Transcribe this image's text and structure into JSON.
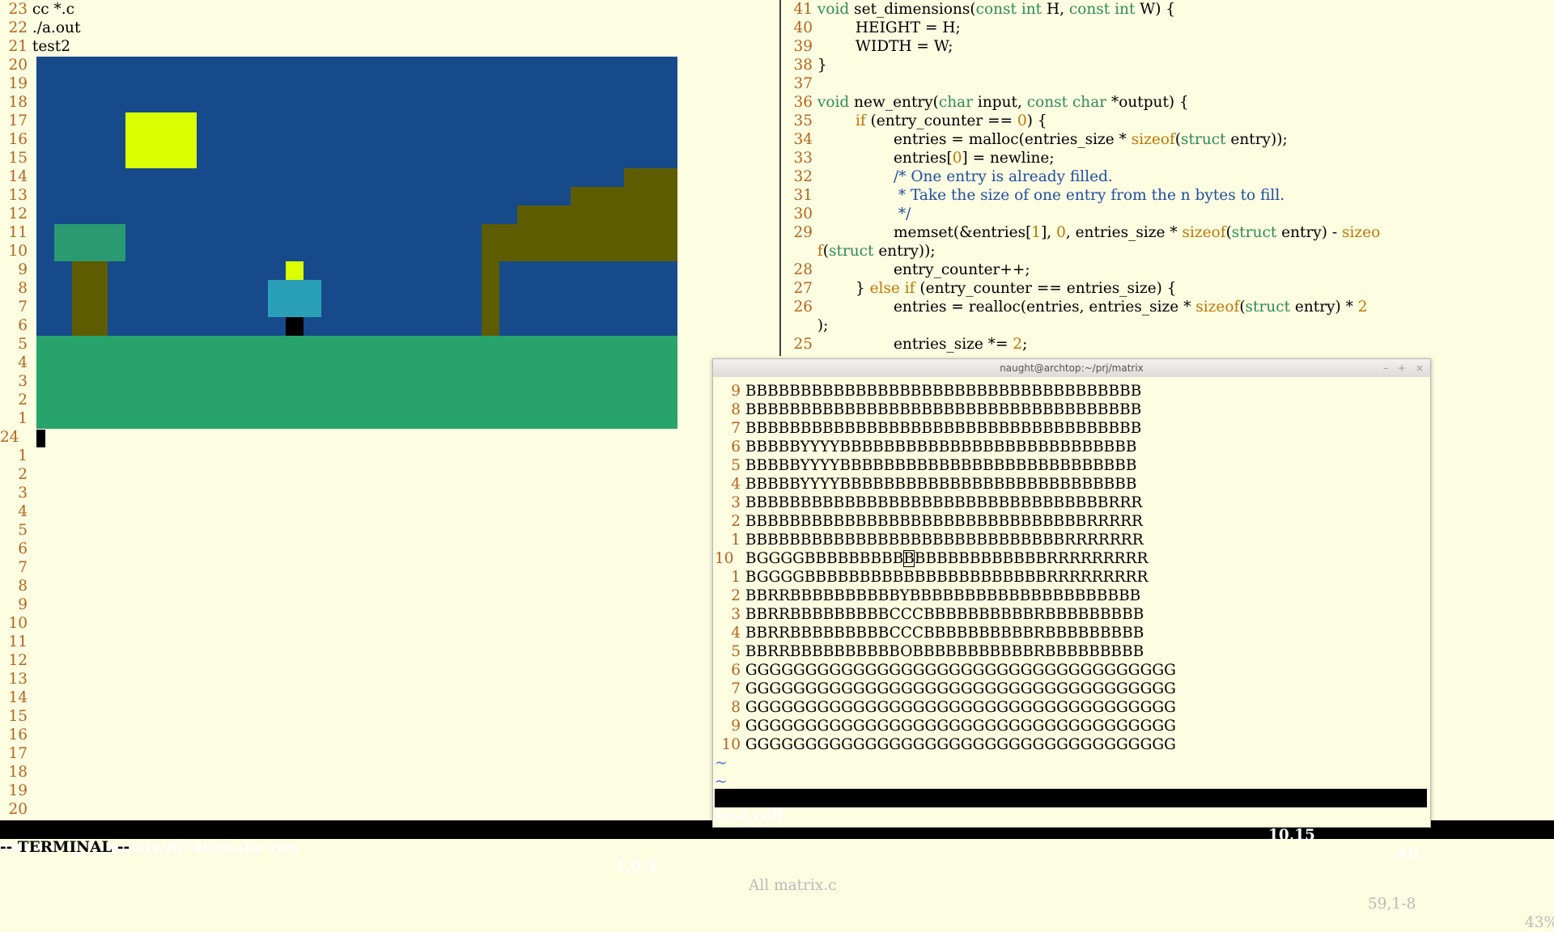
{
  "left": {
    "lines": [
      {
        "n": "23",
        "t": "cc *.c"
      },
      {
        "n": "22",
        "t": "./a.out"
      },
      {
        "n": "21",
        "t": "test2"
      },
      {
        "n": "20",
        "t": ""
      },
      {
        "n": "19",
        "t": ""
      },
      {
        "n": "18",
        "t": ""
      },
      {
        "n": "17",
        "t": ""
      },
      {
        "n": "16",
        "t": ""
      },
      {
        "n": "15",
        "t": ""
      },
      {
        "n": "14",
        "t": ""
      },
      {
        "n": "13",
        "t": ""
      },
      {
        "n": "12",
        "t": ""
      },
      {
        "n": "11",
        "t": ""
      },
      {
        "n": "10",
        "t": ""
      },
      {
        "n": "9",
        "t": ""
      },
      {
        "n": "8",
        "t": ""
      },
      {
        "n": "7",
        "t": ""
      },
      {
        "n": "6",
        "t": ""
      },
      {
        "n": "5",
        "t": ""
      },
      {
        "n": "4",
        "t": ""
      },
      {
        "n": "3",
        "t": ""
      },
      {
        "n": "2",
        "t": ""
      },
      {
        "n": "1",
        "t": ""
      },
      {
        "n": "24",
        "t": ""
      },
      {
        "n": "1",
        "t": ""
      },
      {
        "n": "2",
        "t": ""
      },
      {
        "n": "3",
        "t": ""
      },
      {
        "n": "4",
        "t": ""
      },
      {
        "n": "5",
        "t": ""
      },
      {
        "n": "6",
        "t": ""
      },
      {
        "n": "7",
        "t": ""
      },
      {
        "n": "8",
        "t": ""
      },
      {
        "n": "9",
        "t": ""
      },
      {
        "n": "10",
        "t": ""
      },
      {
        "n": "11",
        "t": ""
      },
      {
        "n": "12",
        "t": ""
      },
      {
        "n": "13",
        "t": ""
      },
      {
        "n": "14",
        "t": ""
      },
      {
        "n": "15",
        "t": ""
      },
      {
        "n": "16",
        "t": ""
      },
      {
        "n": "17",
        "t": ""
      },
      {
        "n": "18",
        "t": ""
      },
      {
        "n": "19",
        "t": ""
      },
      {
        "n": "20",
        "t": ""
      }
    ]
  },
  "scene": {
    "colors": {
      "sky": "#174a8a",
      "sun": "#d9ff00",
      "ground": "#27a36b",
      "leaves": "#2a9a72",
      "trunk": "#5e5c00",
      "player_head": "#d9ff00",
      "player_body": "#2aa0b8",
      "player_legs": "#000000"
    }
  },
  "code": {
    "lines": [
      {
        "n": "41",
        "h": "<span class='kw'>void</span> set_dimensions(<span class='kw'>const int</span> H, <span class='kw'>const int</span> W) {"
      },
      {
        "n": "40",
        "h": "        HEIGHT = H;"
      },
      {
        "n": "39",
        "h": "        WIDTH = W;"
      },
      {
        "n": "38",
        "h": "}"
      },
      {
        "n": "37",
        "h": ""
      },
      {
        "n": "36",
        "h": "<span class='kw'>void</span> new_entry(<span class='kw'>char</span> input, <span class='kw'>const char</span> *output) {"
      },
      {
        "n": "35",
        "h": "        <span class='cond'>if</span> (entry_counter == <span class='nm'>0</span>) {"
      },
      {
        "n": "34",
        "h": "                entries = malloc(entries_size * <span class='cond'>sizeof</span>(<span class='kw'>struct</span> entry));"
      },
      {
        "n": "33",
        "h": "                entries[<span class='nm'>0</span>] = newline;"
      },
      {
        "n": "32",
        "h": "                <span class='cmt'>/* One entry is already filled.</span>"
      },
      {
        "n": "31",
        "h": "<span class='cmt'>                 * Take the size of one entry from the n bytes to fill.</span>"
      },
      {
        "n": "30",
        "h": "<span class='cmt'>                 */</span>"
      },
      {
        "n": "29",
        "h": "                memset(&amp;entries[<span class='nm'>1</span>], <span class='nm'>0</span>, entries_size * <span class='cond'>sizeof</span>(<span class='kw'>struct</span> entry) - <span class='cond'>sizeo</span>"
      },
      {
        "n": "",
        "h": "<span class='cond'>f</span>(<span class='kw'>struct</span> entry));"
      },
      {
        "n": "28",
        "h": "                entry_counter++;"
      },
      {
        "n": "27",
        "h": "        } <span class='cond'>else if</span> (entry_counter == entries_size) {"
      },
      {
        "n": "26",
        "h": "                entries = realloc(entries, entries_size * <span class='cond'>sizeof</span>(<span class='kw'>struct</span> entry) * <span class='nm'>2</span>"
      },
      {
        "n": "",
        "h": ");"
      },
      {
        "n": "25",
        "h": "                entries_size *= <span class='nm'>2</span>;"
      }
    ]
  },
  "popup": {
    "title": "naught@archtop:~/prj/matrix",
    "buttons": [
      "–",
      "+",
      "×"
    ],
    "lines": [
      {
        "n": "9",
        "t": "BBBBBBBBBBBBBBBBBBBBBBBBBBBBBBBBBBBB"
      },
      {
        "n": "8",
        "t": "BBBBBBBBBBBBBBBBBBBBBBBBBBBBBBBBBBBB"
      },
      {
        "n": "7",
        "t": "BBBBBBBBBBBBBBBBBBBBBBBBBBBBBBBBBBBB"
      },
      {
        "n": "6",
        "t": "BBBBBYYYYBBBBBBBBBBBBBBBBBBBBBBBBBBB"
      },
      {
        "n": "5",
        "t": "BBBBBYYYYBBBBBBBBBBBBBBBBBBBBBBBBBBB"
      },
      {
        "n": "4",
        "t": "BBBBBYYYYBBBBBBBBBBBBBBBBBBBBBBBBBBB"
      },
      {
        "n": "3",
        "t": "BBBBBBBBBBBBBBBBBBBBBBBBBBBBBBBBBRRR"
      },
      {
        "n": "2",
        "t": "BBBBBBBBBBBBBBBBBBBBBBBBBBBBBBBRRRRR"
      },
      {
        "n": "1",
        "t": "BBBBBBBBBBBBBBBBBBBBBBBBBBBBBRRRRRRR"
      },
      {
        "n": "10",
        "t": "BGGGGBBBBBBBBBBBBBBBBBBBBBBRRRRRRRRR",
        "cur": true
      },
      {
        "n": "1",
        "t": "BGGGGBBBBBBBBBBBBBBBBBBBBBBRRRRRRRRR"
      },
      {
        "n": "2",
        "t": "BBRRBBBBBBBBBBYBBBBBBBBBBBBBBBBBBBBB"
      },
      {
        "n": "3",
        "t": "BBRRBBBBBBBBBCCCBBBBBBBBBBRBBBBBBBBB"
      },
      {
        "n": "4",
        "t": "BBRRBBBBBBBBBCCCBBBBBBBBBBRBBBBBBBBB"
      },
      {
        "n": "5",
        "t": "BBRRBBBBBBBBBBOBBBBBBBBBBBRBBBBBBBBB"
      },
      {
        "n": "6",
        "t": "GGGGGGGGGGGGGGGGGGGGGGGGGGGGGGGGGGGG"
      },
      {
        "n": "7",
        "t": "GGGGGGGGGGGGGGGGGGGGGGGGGGGGGGGGGGGG"
      },
      {
        "n": "8",
        "t": "GGGGGGGGGGGGGGGGGGGGGGGGGGGGGGGGGGGG"
      },
      {
        "n": "9",
        "t": "GGGGGGGGGGGGGGGGGGGGGGGGGGGGGGGGGGGG"
      },
      {
        "n": "10",
        "t": "GGGGGGGGGGGGGGGGGGGGGGGGGGGGGGGGGGGG"
      }
    ],
    "tilde": "~",
    "status_file": "test.cell",
    "status_pos": "10,15",
    "status_all": "All"
  },
  "statusbar": {
    "term": "term://~/prj/matrix//6746:make run",
    "pos": "1,0-1",
    "file": "All matrix.c",
    "filepos": "59,1-8",
    "percent": "43%"
  },
  "mode": "-- TERMINAL --"
}
